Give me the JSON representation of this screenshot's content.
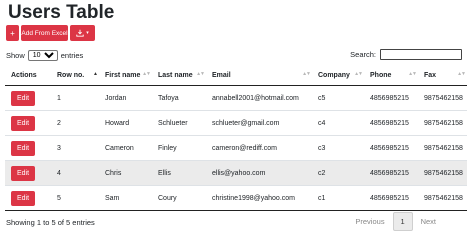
{
  "title": "Users Table",
  "toolbar": {
    "plus_label": "+",
    "excel_label": "Add From Excel",
    "download_icon": "download-icon",
    "caret": "▾"
  },
  "length": {
    "show": "Show",
    "value": "10",
    "entries": "entries",
    "options": [
      "10"
    ]
  },
  "search": {
    "label": "Search:",
    "value": ""
  },
  "columns": [
    "Actions",
    "Row no.",
    "First name",
    "Last name",
    "Email",
    "Company",
    "Phone",
    "Fax"
  ],
  "rows": [
    {
      "action": "Edit",
      "row": "1",
      "first": "Jordan",
      "last": "Tafoya",
      "email": "annabell2001@hotmail.com",
      "company": "c5",
      "phone": "4856985215",
      "fax": "9875462158"
    },
    {
      "action": "Edit",
      "row": "2",
      "first": "Howard",
      "last": "Schlueter",
      "email": "schlueter@gmail.com",
      "company": "c4",
      "phone": "4856985215",
      "fax": "9875462158"
    },
    {
      "action": "Edit",
      "row": "3",
      "first": "Cameron",
      "last": "Finley",
      "email": "cameron@rediff.com",
      "company": "c3",
      "phone": "4856985215",
      "fax": "9875462158"
    },
    {
      "action": "Edit",
      "row": "4",
      "first": "Chris",
      "last": "Ellis",
      "email": "ellis@yahoo.com",
      "company": "c2",
      "phone": "4856985215",
      "fax": "9875462158"
    },
    {
      "action": "Edit",
      "row": "5",
      "first": "Sam",
      "last": "Coury",
      "email": "christine1998@yahoo.com",
      "company": "c1",
      "phone": "4856985215",
      "fax": "9875462158"
    }
  ],
  "info": "Showing 1 to 5 of 5 entries",
  "pagination": {
    "previous": "Previous",
    "current": "1",
    "next": "Next"
  },
  "colors": {
    "accent": "#dc3545",
    "row_highlight": "#ebebeb"
  }
}
